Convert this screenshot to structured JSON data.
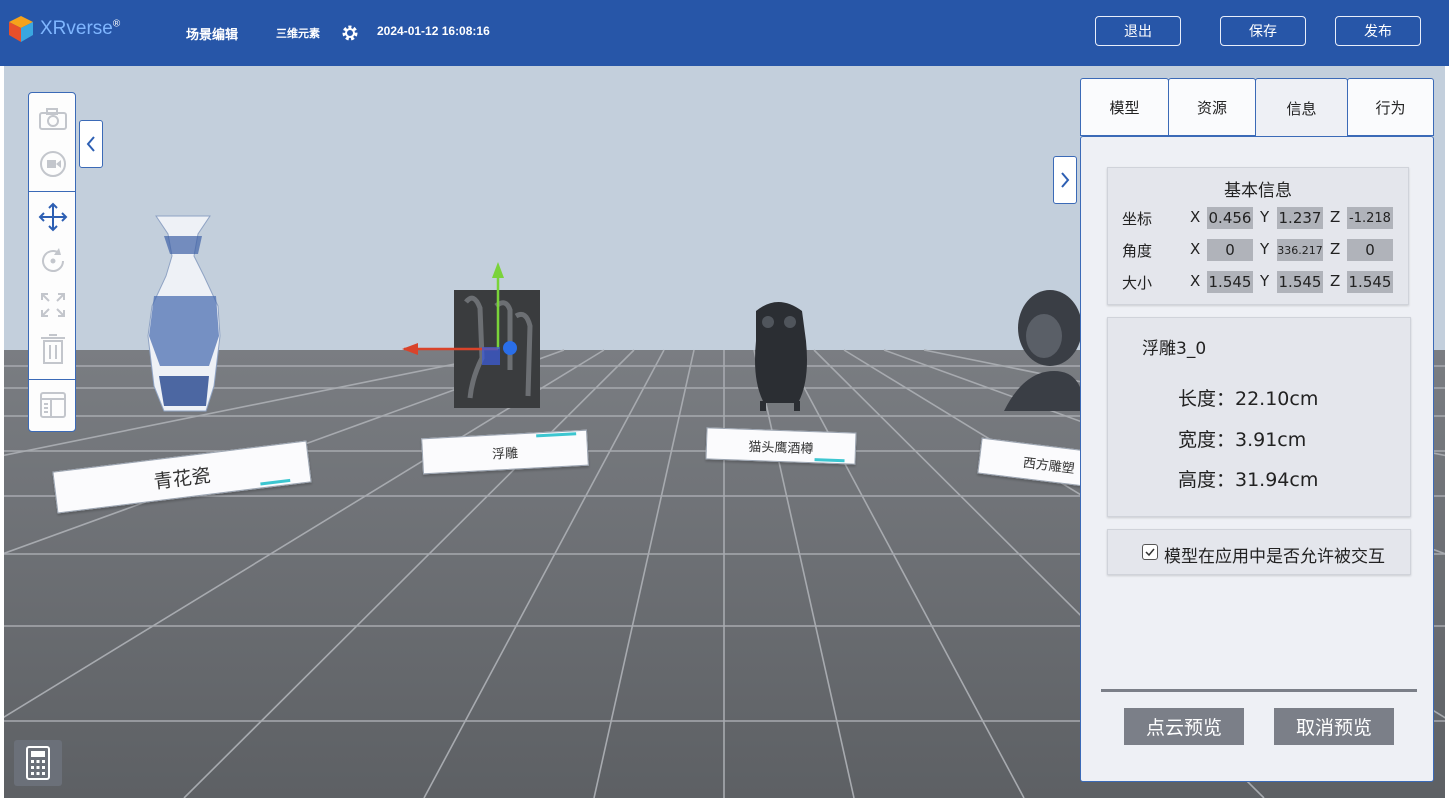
{
  "header": {
    "brand": "XRverse",
    "brand_mark": "®",
    "title": "场景编辑",
    "element": "三维元素",
    "datetime": "2024-01-12 16:08:16",
    "exit_label": "退出",
    "save_label": "保存",
    "publish_label": "发布"
  },
  "scene": {
    "labels": [
      "青花瓷",
      "浮雕",
      "猫头鹰酒樽",
      "西方雕塑"
    ]
  },
  "panel": {
    "tabs": [
      {
        "label": "模型"
      },
      {
        "label": "资源"
      },
      {
        "label": "信息",
        "active": true
      },
      {
        "label": "行为"
      }
    ],
    "basic_info_title": "基本信息",
    "rows": [
      {
        "label": "坐标",
        "x": "0.456",
        "y": "1.237",
        "z": "-1.218"
      },
      {
        "label": "角度",
        "x": "0",
        "y": "336.217",
        "z": "0"
      },
      {
        "label": "大小",
        "x": "1.545",
        "y": "1.545",
        "z": "1.545"
      }
    ],
    "axis_x": "X",
    "axis_y": "Y",
    "axis_z": "Z",
    "model_name": "浮雕3_0",
    "length": "长度：22.10cm",
    "width": "宽度：3.91cm",
    "height": "高度：31.94cm",
    "interact_label": "模型在应用中是否允许被交互",
    "interact_checked": true,
    "pointcloud_preview": "点云预览",
    "cancel_preview": "取消预览"
  }
}
